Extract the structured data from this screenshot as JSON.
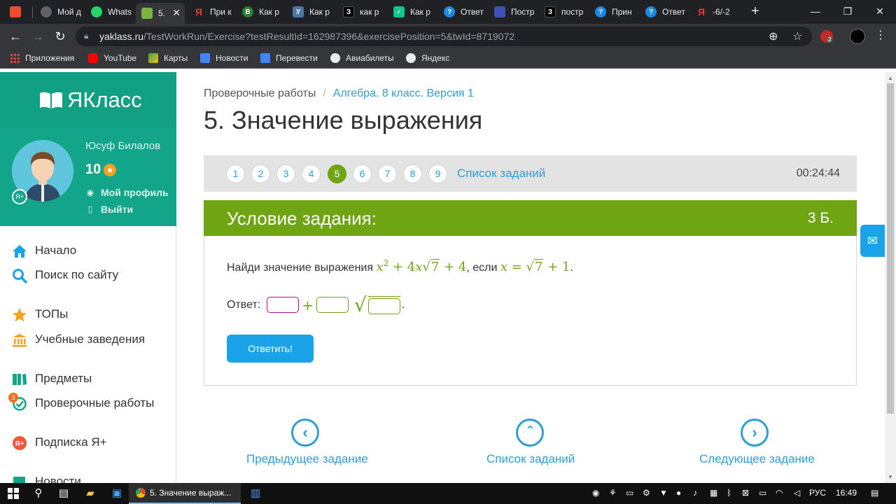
{
  "browser": {
    "tabs": [
      {
        "label": "",
        "color": "#ee4d2d"
      },
      {
        "label": "Мой д",
        "color": "#5f6368"
      },
      {
        "label": "Whats",
        "color": "#25d366"
      },
      {
        "label": "5.",
        "color": "#7cb342"
      },
      {
        "label": "При к",
        "color": "#e53935"
      },
      {
        "label": "Как р",
        "color": "#2e7d32"
      },
      {
        "label": "Как р",
        "color": "#4a76a8"
      },
      {
        "label": "как р",
        "color": "#000000"
      },
      {
        "label": "Как р",
        "color": "#14c68a"
      },
      {
        "label": "Ответ",
        "color": "#1e88e5"
      },
      {
        "label": "Постр",
        "color": "#3f51b5"
      },
      {
        "label": "постр",
        "color": "#000000"
      },
      {
        "label": "Прин",
        "color": "#1e88e5"
      },
      {
        "label": "Ответ",
        "color": "#1e88e5"
      },
      {
        "label": "-6/-2",
        "color": "#e53935"
      }
    ],
    "url_host": "yaklass.ru",
    "url_path": "/TestWorkRun/Exercise?testResultId=162987396&exercisePosition=5&twId=8719072",
    "bookmarks": [
      "Приложения",
      "YouTube",
      "Карты",
      "Новости",
      "Перевести",
      "Авиабилеты",
      "Яндекс"
    ],
    "extension_badge": "2"
  },
  "sidebar": {
    "logo": "ЯКласс",
    "user_name": "Юсуф Билалов",
    "score": "10",
    "profile_link": "Мой профиль",
    "logout_link": "Выйти",
    "menu": {
      "home": "Начало",
      "search": "Поиск по сайту",
      "tops": "ТОПы",
      "schools": "Учебные заведения",
      "subjects": "Предметы",
      "tests": "Проверочные работы",
      "tests_badge": "3",
      "subscription": "Подписка Я+",
      "news": "Новости"
    }
  },
  "main": {
    "breadcrumb_root": "Проверочные работы",
    "breadcrumb_current": "Алгебра. 8 класс. Версия 1",
    "title": "5. Значение выражения",
    "question_numbers": [
      "1",
      "2",
      "3",
      "4",
      "5",
      "6",
      "7",
      "8",
      "9"
    ],
    "current_question": "5",
    "task_list_link": "Список заданий",
    "timer": "00:24:44",
    "condition_title": "Условие задания:",
    "points": "3 Б.",
    "task_text_prefix": "Найди значение выражения",
    "task_text_if": ", если",
    "answer_label": "Ответ:",
    "answer_plus": "+",
    "answer_dot": ".",
    "answer_button": "Ответить!",
    "nav_prev": "Предыдущее задание",
    "nav_list": "Список заданий",
    "nav_next": "Следующее задание"
  },
  "taskbar": {
    "active_window": "5. Значение выраж...",
    "lang": "РУС",
    "time": "16:49"
  }
}
